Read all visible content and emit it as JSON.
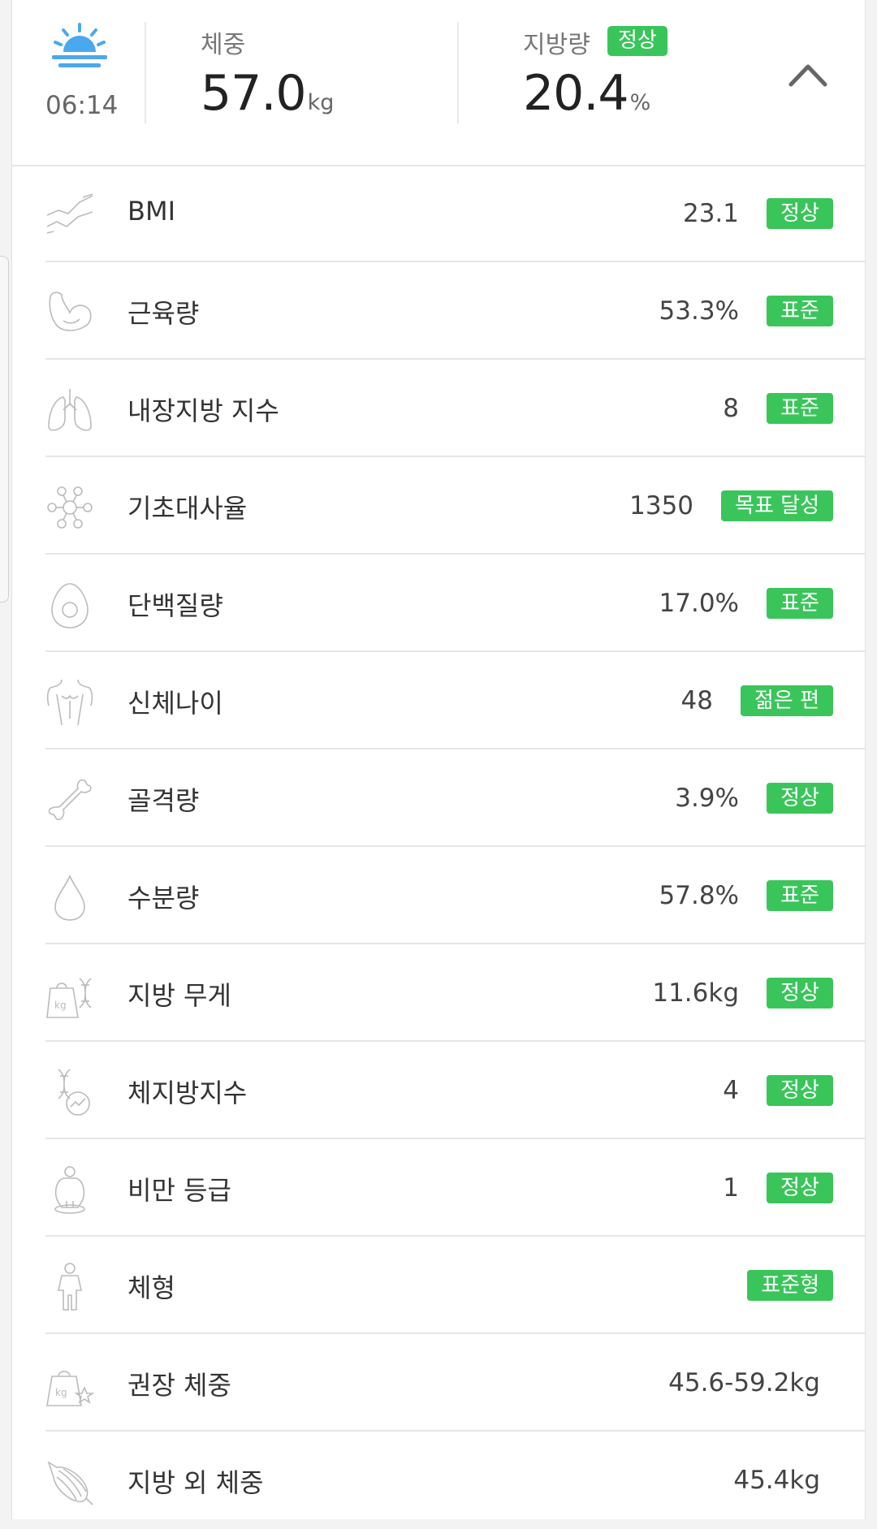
{
  "header": {
    "time": "06:14",
    "time_icon": "sunrise-icon",
    "weight_label": "체중",
    "weight_value": "57.0",
    "weight_unit": "kg",
    "fat_label": "지방량",
    "fat_badge": "정상",
    "fat_value": "20.4",
    "fat_unit": "%",
    "collapse_icon": "chevron-up-icon"
  },
  "colors": {
    "badge": "#3ac55b",
    "sun": "#4aa8ee"
  },
  "rows": [
    {
      "icon": "trend-lines-icon",
      "label": "BMI",
      "value": "23.1",
      "badge": "정상"
    },
    {
      "icon": "arm-muscle-icon",
      "label": "근육량",
      "value": "53.3%",
      "badge": "표준"
    },
    {
      "icon": "lungs-icon",
      "label": "내장지방 지수",
      "value": "8",
      "badge": "표준"
    },
    {
      "icon": "molecule-icon",
      "label": "기초대사율",
      "value": "1350",
      "badge": "목표 달성"
    },
    {
      "icon": "egg-icon",
      "label": "단백질량",
      "value": "17.0%",
      "badge": "표준"
    },
    {
      "icon": "torso-icon",
      "label": "신체나이",
      "value": "48",
      "badge": "젊은 편"
    },
    {
      "icon": "bone-icon",
      "label": "골격량",
      "value": "3.9%",
      "badge": "정상"
    },
    {
      "icon": "water-drop-icon",
      "label": "수분량",
      "value": "57.8%",
      "badge": "표준"
    },
    {
      "icon": "weight-dna-icon",
      "label": "지방 무게",
      "value": "11.6kg",
      "badge": "정상"
    },
    {
      "icon": "dna-chart-icon",
      "label": "체지방지수",
      "value": "4",
      "badge": "정상"
    },
    {
      "icon": "obese-person-icon",
      "label": "비만 등급",
      "value": "1",
      "badge": "정상"
    },
    {
      "icon": "body-type-icon",
      "label": "체형",
      "value": "",
      "badge": "표준형"
    },
    {
      "icon": "weight-star-icon",
      "label": "권장 체중",
      "value": "45.6-59.2kg",
      "badge": ""
    },
    {
      "icon": "muscle-fiber-icon",
      "label": "지방 외 체중",
      "value": "45.4kg",
      "badge": ""
    }
  ]
}
